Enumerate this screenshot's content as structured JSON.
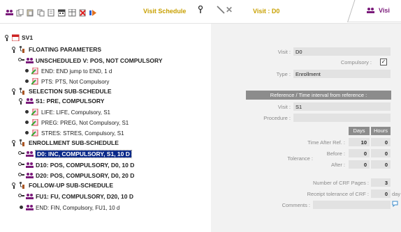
{
  "toolbar": {
    "title": "Visit Schedule",
    "visit_label": "Visit : D0",
    "tab_label": "Visi",
    "icons": [
      "visits-icon",
      "copy-icon",
      "paste-icon",
      "duplicate-icon",
      "document-icon",
      "calendar-icon",
      "table-icon",
      "delete-icon",
      "arrow-icon",
      "pin-icon",
      "wand-icon",
      "close-icon",
      "visits-icon"
    ]
  },
  "tree": {
    "root": "SV1",
    "floating": "FLOATING PARAMETERS",
    "unscheduled": "UNSCHEDULED V: POS, NOT COMPULSORY",
    "end": "END: END jump to END, 1 d",
    "pts": "PTS: PTS, Not Compulsory",
    "selection": "SELECTION SUB-SCHEDULE",
    "s1": "S1: PRE, COMPULSORY",
    "life": "LIFE: LIFE, Compulsory, S1",
    "preg": "PREG: PREG, Not Compulsory, S1",
    "stres": "STRES: STRES, Compulsory, S1",
    "enrollment": "ENROLLMENT SUB-SCHEDULE",
    "d0": "D0: INC, COMPULSORY, S1, 10 D",
    "d10": "D10: POS, COMPULSORY, D0, 10 D",
    "d20": "D20: POS, COMPULSORY, D0, 20 D",
    "followup": "FOLLOW-UP SUB-SCHEDULE",
    "fu1": "FU1: FU, COMPULSORY, D20, 10 D",
    "endfin": "END: FIN, Compulsory, FU1, 10 d"
  },
  "panel": {
    "visit_label": "Visit :",
    "visit_value": "D0",
    "compulsory_label": "Compulsory :",
    "compulsory_checked": "✓",
    "type_label": "Type :",
    "type_value": "Enrollment",
    "reference_header": "Reference / Time interval from reference :",
    "ref_visit_label": "Visit :",
    "ref_visit_value": "S1",
    "procedure_label": "Procedure :",
    "procedure_value": "",
    "days_header": "Days",
    "hours_header": "Hours",
    "time_after_label": "Time After Ref. :",
    "time_after_days": "10",
    "time_after_hours": "0",
    "tolerance_label": "Tolerance :",
    "before_label": "Before :",
    "before_days": "0",
    "before_hours": "0",
    "after_label": "After :",
    "after_days": "0",
    "after_hours": "0",
    "crf_pages_label": "Number of CRF Pages :",
    "crf_pages_value": "3",
    "receipt_label": "Receipt tolerance of CRF :",
    "receipt_value": "0",
    "receipt_unit": "day",
    "comments_label": "Comments :",
    "comments_value": ""
  },
  "colors": {
    "accent_gold": "#c8a000",
    "selection_blue": "#0b2a8a",
    "panel_bg": "#f2f2f2",
    "field_bg": "#e2e2e2",
    "header_gray": "#8c8c8c"
  }
}
